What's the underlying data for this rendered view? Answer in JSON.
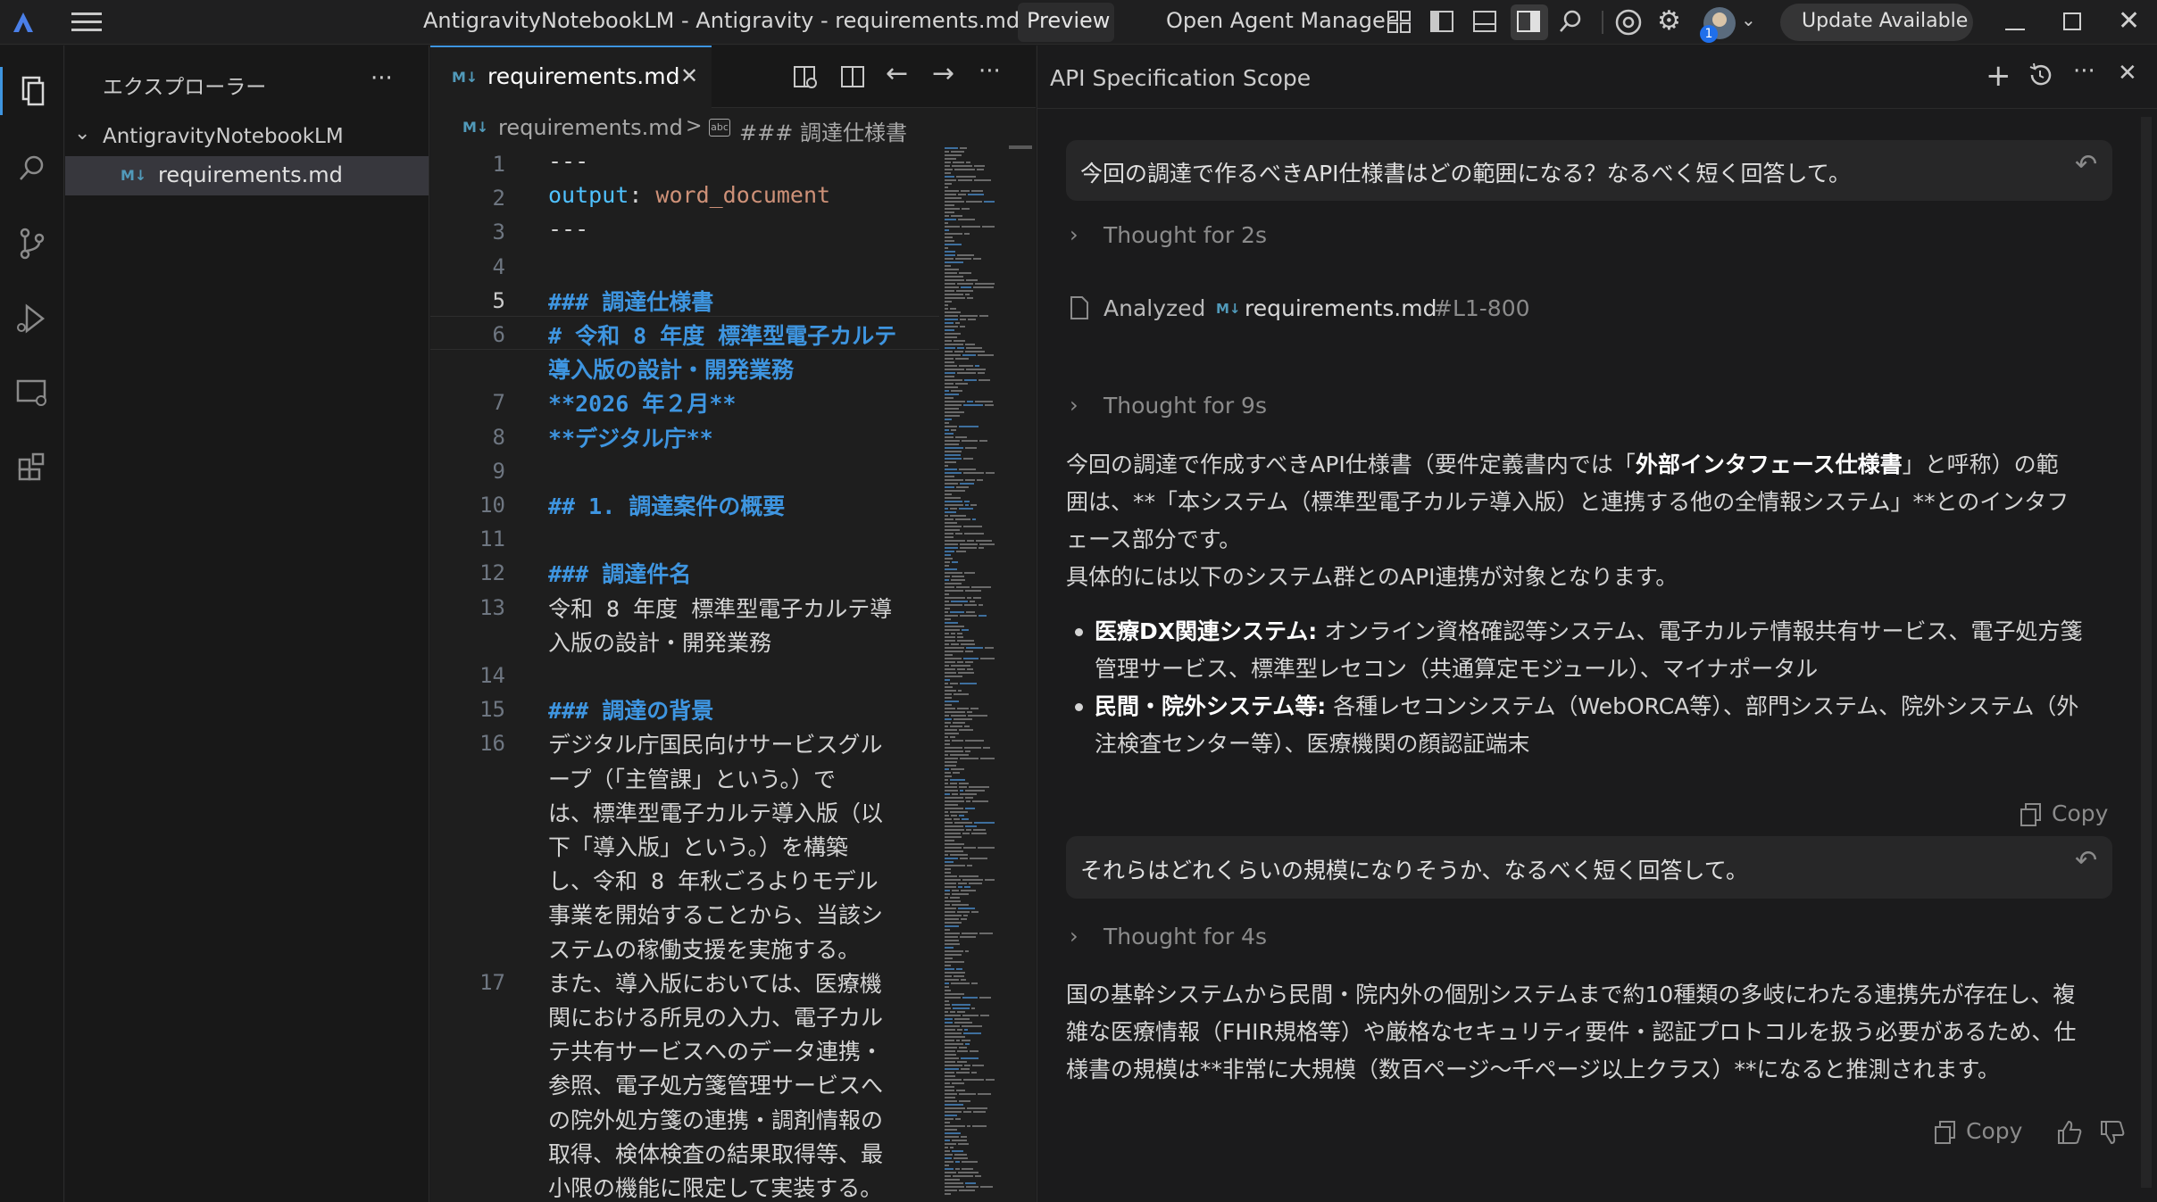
{
  "titlebar": {
    "title": "AntigravityNotebookLM - Antigravity - requirements.md",
    "preview": "Preview",
    "open_agent_manager": "Open Agent Manager",
    "update": "Update Available",
    "badge": "1"
  },
  "sidebar": {
    "title": "エクスプローラー",
    "more": "···",
    "folder": "AntigravityNotebookLM",
    "file": "requirements.md",
    "md_badge": "M↓"
  },
  "editor": {
    "tab": "requirements.md",
    "tab_close": "✕",
    "breadcrumb_file": "requirements.md",
    "breadcrumb_sep": ">",
    "breadcrumb_symbol": "### 調達仕様書",
    "lines": [
      {
        "n": "1",
        "rows": [
          "---"
        ]
      },
      {
        "n": "2",
        "rows": [
          "output: word_document"
        ]
      },
      {
        "n": "3",
        "rows": [
          "---"
        ]
      },
      {
        "n": "4",
        "rows": [
          ""
        ]
      },
      {
        "n": "5",
        "rows": [
          "### 調達仕様書"
        ]
      },
      {
        "n": "6",
        "rows": [
          "# 令和 8 年度 標準型電子カルテ",
          "導入版の設計・開発業務"
        ]
      },
      {
        "n": "7",
        "rows": [
          "**2026 年２月**"
        ]
      },
      {
        "n": "8",
        "rows": [
          "**デジタル庁**"
        ]
      },
      {
        "n": "9",
        "rows": [
          ""
        ]
      },
      {
        "n": "10",
        "rows": [
          "## 1. 調達案件の概要"
        ]
      },
      {
        "n": "11",
        "rows": [
          ""
        ]
      },
      {
        "n": "12",
        "rows": [
          "### 調達件名"
        ]
      },
      {
        "n": "13",
        "rows": [
          "令和 8 年度 標準型電子カルテ導",
          "入版の設計・開発業務"
        ]
      },
      {
        "n": "14",
        "rows": [
          ""
        ]
      },
      {
        "n": "15",
        "rows": [
          "### 調達の背景"
        ]
      },
      {
        "n": "16",
        "rows": [
          "デジタル庁国民向けサービスグル",
          "ープ（「主管課」という。）で",
          "は、標準型電子カルテ導入版（以",
          "下「導入版」という。）を構築",
          "し、令和 8 年秋ごろよりモデル",
          "事業を開始することから、当該シ",
          "ステムの稼働支援を実施する。"
        ]
      },
      {
        "n": "17",
        "rows": [
          "また、導入版においては、医療機",
          "関における所見の入力、電子カル",
          "テ共有サービスへのデータ連携・",
          "参照、電子処方箋管理サービスへ",
          "の院外処方箋の連携・調剤情報の",
          "取得、検体検査の結果取得等、最",
          "小限の機能に限定して実装する。"
        ]
      }
    ]
  },
  "agent": {
    "title": "API Specification Scope",
    "q1": "今回の調達で作るべきAPI仕様書はどの範囲になる？なるべく短く回答して。",
    "thought1": "Thought for 2s",
    "analyzed_label": "Analyzed",
    "analyzed_file": "requirements.md",
    "analyzed_range": "#L1-800",
    "thought2": "Thought for 9s",
    "a1_p1_a": "今回の調達で作成すべきAPI仕様書（要件定義書内では「",
    "a1_p1_b": "外部インタフェース仕様書",
    "a1_p1_c": "」と呼称）の範",
    "a1_p1_line2": "囲は、**「本システム（標準型電子カルテ導入版）と連携する他の全情報システム」**とのインタフ",
    "a1_p1_line3": "ェース部分です。",
    "a1_p2": "具体的には以下のシステム群とのAPI連携が対象となります。",
    "b1_bold": "医療DX関連システム:",
    "b1_line1": " オンライン資格確認等システム、電子カルテ情報共有サービス、電子処方箋",
    "b1_line2": "管理サービス、標準型レセコン（共通算定モジュール）、マイナポータル",
    "b2_bold": "民間・院外システム等:",
    "b2_line1": " 各種レセコンシステム（WebORCA等）、部門システム、院外システム（外",
    "b2_line2": "注検査センター等）、医療機関の顔認証端末",
    "copy": "Copy",
    "q2": "それらはどれくらいの規模になりそうか、なるべく短く回答して。",
    "thought3": "Thought for 4s",
    "a2_line1": "国の基幹システムから民間・院内外の個別システムまで約10種類の多岐にわたる連携先が存在し、複",
    "a2_line2": "雑な医療情報（FHIR規格等）や厳格なセキュリティ要件・認証プロトコルを扱う必要があるため、仕",
    "a2_line3": "様書の規模は**非常に大規模（数百ページ〜千ページ以上クラス）**になると推測されます。"
  },
  "colors": {
    "accent": "#3e95e0",
    "string": "#ce9178",
    "key": "#4fc1ff"
  }
}
